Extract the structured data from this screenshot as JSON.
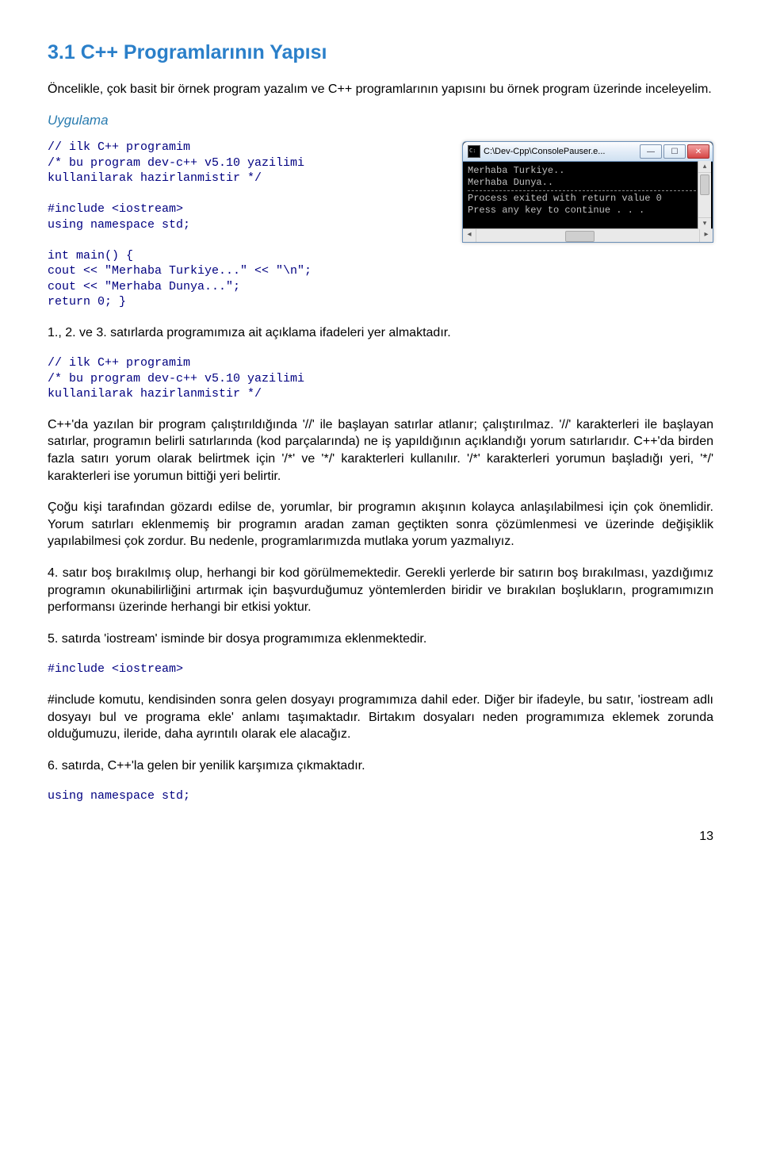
{
  "heading": "3.1 C++ Programlarının Yapısı",
  "intro": "Öncelikle, çok basit bir örnek program yazalım ve C++ programlarının yapısını bu örnek program üzerinde inceleyelim.",
  "uygulama": "Uygulama",
  "code1": "// ilk C++ programim\n/* bu program dev-c++ v5.10 yazilimi\nkullanilarak hazirlanmistir */\n\n#include <iostream>\nusing namespace std;\n\nint main() {\ncout << \"Merhaba Turkiye...\" << \"\\n\";\ncout << \"Merhaba Dunya...\";\nreturn 0; }",
  "win": {
    "title": "C:\\Dev-Cpp\\ConsolePauser.e...",
    "line1": "Merhaba Turkiye..",
    "line2": "Merhaba Dunya..",
    "line3": "Process exited with return value 0",
    "line4": "Press any key to continue . . ."
  },
  "p1": "1., 2. ve 3. satırlarda programımıza ait açıklama ifadeleri yer almaktadır.",
  "code2": "// ilk C++ programim\n/* bu program dev-c++ v5.10 yazilimi\nkullanilarak hazirlanmistir */",
  "p2": "C++'da yazılan bir program çalıştırıldığında '//' ile başlayan satırlar atlanır; çalıştırılmaz. '//' karakterleri ile başlayan satırlar, programın belirli satırlarında (kod parçalarında) ne iş yapıldığının açıklandığı yorum satırlarıdır. C++'da birden fazla satırı yorum olarak belirtmek için '/*' ve '*/' karakterleri kullanılır. '/*' karakterleri yorumun başladığı yeri, '*/' karakterleri ise yorumun bittiği yeri belirtir.",
  "p3": "Çoğu kişi tarafından gözardı edilse de, yorumlar, bir programın akışının kolayca anlaşılabilmesi için çok önemlidir. Yorum satırları eklenmemiş bir programın aradan zaman geçtikten sonra çözümlenmesi ve üzerinde değişiklik yapılabilmesi çok zordur. Bu nedenle, programlarımızda mutlaka yorum yazmalıyız.",
  "p4": "4. satır boş bırakılmış olup, herhangi bir kod görülmemektedir. Gerekli yerlerde bir satırın boş bırakılması, yazdığımız programın okunabilirliğini artırmak için başvurduğumuz yöntemlerden biridir ve bırakılan boşlukların, programımızın performansı üzerinde herhangi bir etkisi yoktur.",
  "p5": "5. satırda 'iostream' isminde bir dosya programımıza eklenmektedir.",
  "code3": "#include <iostream>",
  "p6": "#include komutu, kendisinden sonra gelen dosyayı programımıza dahil eder. Diğer bir ifadeyle, bu satır, 'iostream adlı dosyayı bul ve programa ekle' anlamı taşımaktadır. Birtakım dosyaları neden programımıza eklemek zorunda olduğumuzu, ileride, daha ayrıntılı olarak ele alacağız.",
  "p7": "6. satırda, C++'la gelen bir yenilik karşımıza çıkmaktadır.",
  "code4": "using namespace std;",
  "pagenum": "13"
}
